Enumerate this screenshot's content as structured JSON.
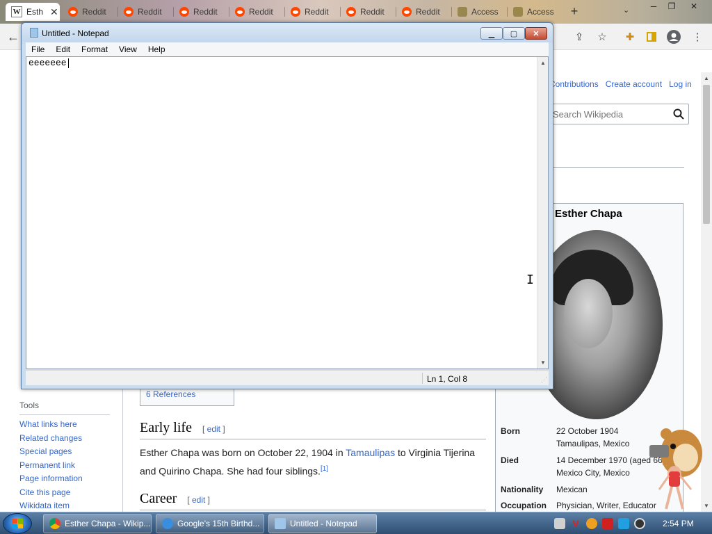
{
  "browser": {
    "tabs": [
      {
        "label": "Esth",
        "type": "wiki",
        "active": true
      },
      {
        "label": "Reddit",
        "type": "reddit"
      },
      {
        "label": "Reddit",
        "type": "reddit"
      },
      {
        "label": "Reddit",
        "type": "reddit"
      },
      {
        "label": "Reddit",
        "type": "reddit"
      },
      {
        "label": "Reddit",
        "type": "reddit"
      },
      {
        "label": "Reddit",
        "type": "reddit"
      },
      {
        "label": "Reddit",
        "type": "reddit"
      },
      {
        "label": "Access",
        "type": "access"
      },
      {
        "label": "Access",
        "type": "access"
      }
    ],
    "tab_close": "✕",
    "new_tab": "+"
  },
  "wiki": {
    "user_links": [
      "Contributions",
      "Create account",
      "Log in"
    ],
    "search_placeholder": "Search Wikipedia",
    "toc_item": "6  References",
    "tools_heading": "Tools",
    "tools": [
      "What links here",
      "Related changes",
      "Special pages",
      "Permanent link",
      "Page information",
      "Cite this page",
      "Wikidata item"
    ],
    "sections": {
      "early_life": "Early life",
      "career": "Career",
      "edit": "edit"
    },
    "paragraph": {
      "part1": "Esther Chapa was born on October 22, 1904 in ",
      "link": "Tamaulipas",
      "part2": " to Virginia Tijerina and Quirino Chapa. She had four siblings.",
      "ref": "[1]"
    },
    "infobox": {
      "title": "Esther Chapa",
      "born_label": "Born",
      "born_date": "22 October 1904",
      "born_place": "Tamaulipas, Mexico",
      "died_label": "Died",
      "died_date": "14 December 1970 (aged 66)",
      "died_place": "Mexico City, Mexico",
      "nationality_label": "Nationality",
      "nationality": "Mexican",
      "occupation_label": "Occupation",
      "occupation": "Physician, Writer, Educator"
    }
  },
  "notepad": {
    "title": "Untitled - Notepad",
    "menu": [
      "File",
      "Edit",
      "Format",
      "View",
      "Help"
    ],
    "content": "eeeeeee",
    "status_position": "Ln 1, Col 8"
  },
  "taskbar": {
    "buttons": [
      {
        "label": "Esther Chapa - Wikip...",
        "icon": "chrome-icon"
      },
      {
        "label": "Google's 15th Birthd...",
        "icon": "ie-icon"
      },
      {
        "label": "Untitled - Notepad",
        "icon": "notepad-icon",
        "active": true
      }
    ],
    "clock": "2:54 PM"
  },
  "colors": {
    "link": "#3366cc",
    "reddit": "#ff4500",
    "taskbar_top": "#5b7fa6",
    "taskbar_bottom": "#2f4e72"
  }
}
